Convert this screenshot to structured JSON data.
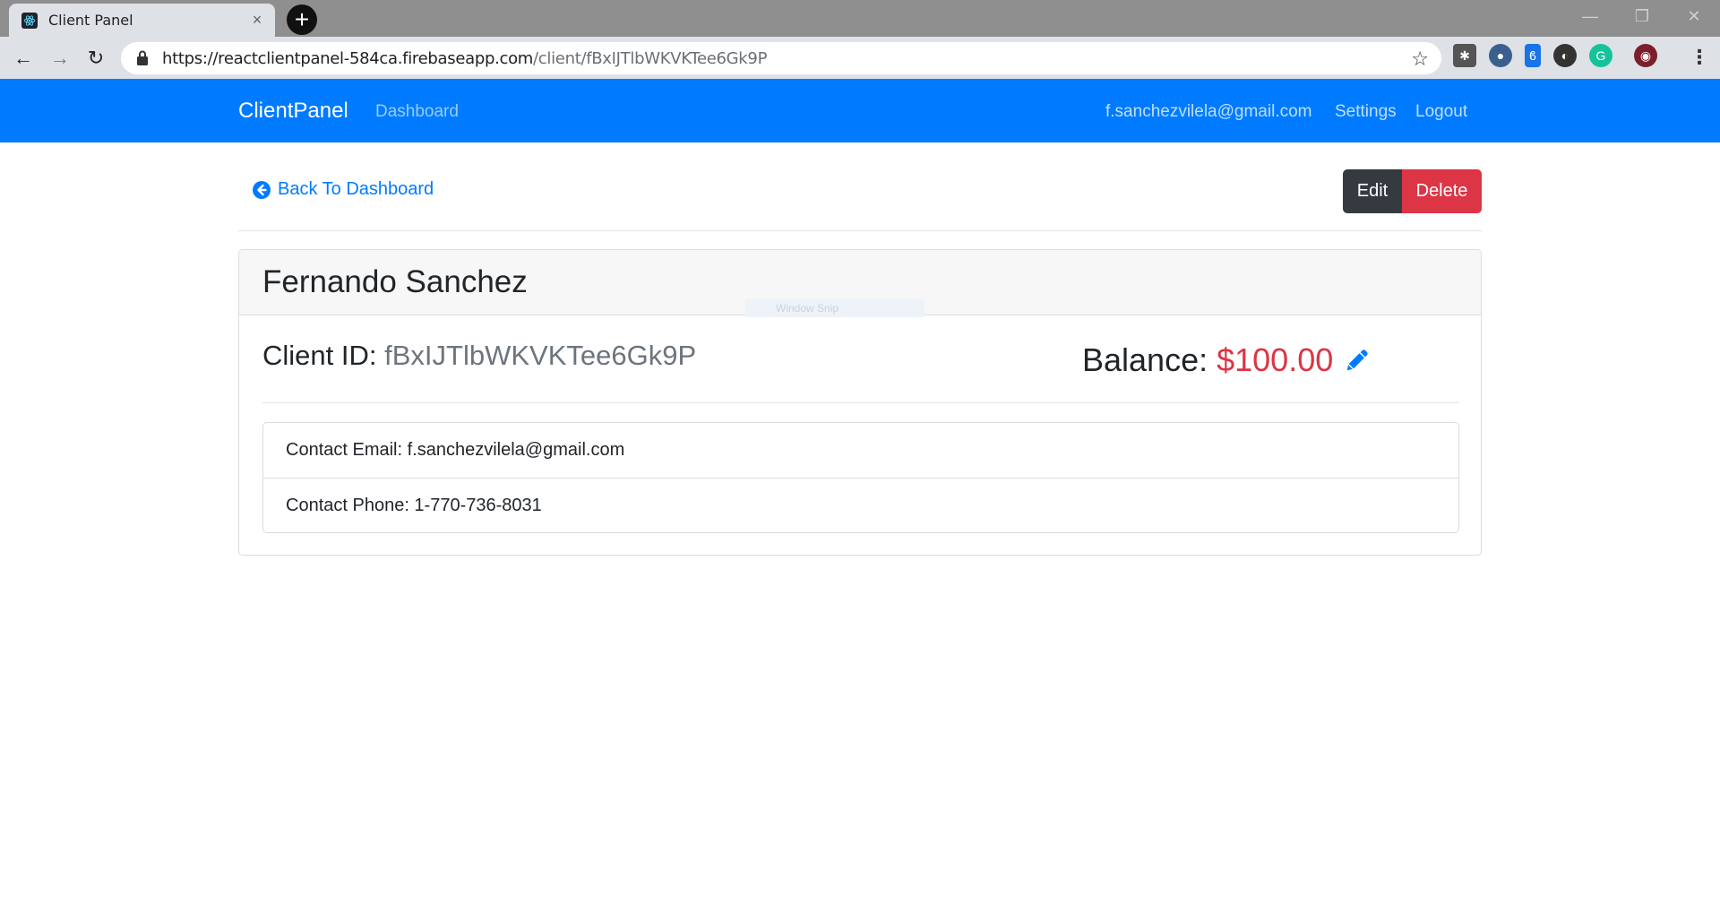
{
  "browser": {
    "tab_title": "Client Panel",
    "url_host": "https://reactclientpanel-584ca.firebaseapp.com",
    "url_path": "/client/fBxIJTlbWKVKTee6Gk9P"
  },
  "navbar": {
    "brand": "ClientPanel",
    "dashboard_link": "Dashboard",
    "user_email": "f.sanchezvilela@gmail.com",
    "settings_link": "Settings",
    "logout_link": "Logout"
  },
  "actions": {
    "back_label": "Back To Dashboard",
    "edit_label": "Edit",
    "delete_label": "Delete"
  },
  "client": {
    "name": "Fernando Sanchez",
    "id_label": "Client ID:",
    "id_value": "fBxIJTlbWKVKTee6Gk9P",
    "balance_label": "Balance:",
    "balance_value": "$100.00",
    "contact_email": "Contact Email: f.sanchezvilela@gmail.com",
    "contact_phone": "Contact Phone: 1-770-736-8031"
  },
  "overlay": {
    "snip_text": "Window Snip"
  },
  "colors": {
    "primary": "#007bff",
    "danger": "#dc3545",
    "dark": "#343a40",
    "muted": "#6c757d"
  }
}
